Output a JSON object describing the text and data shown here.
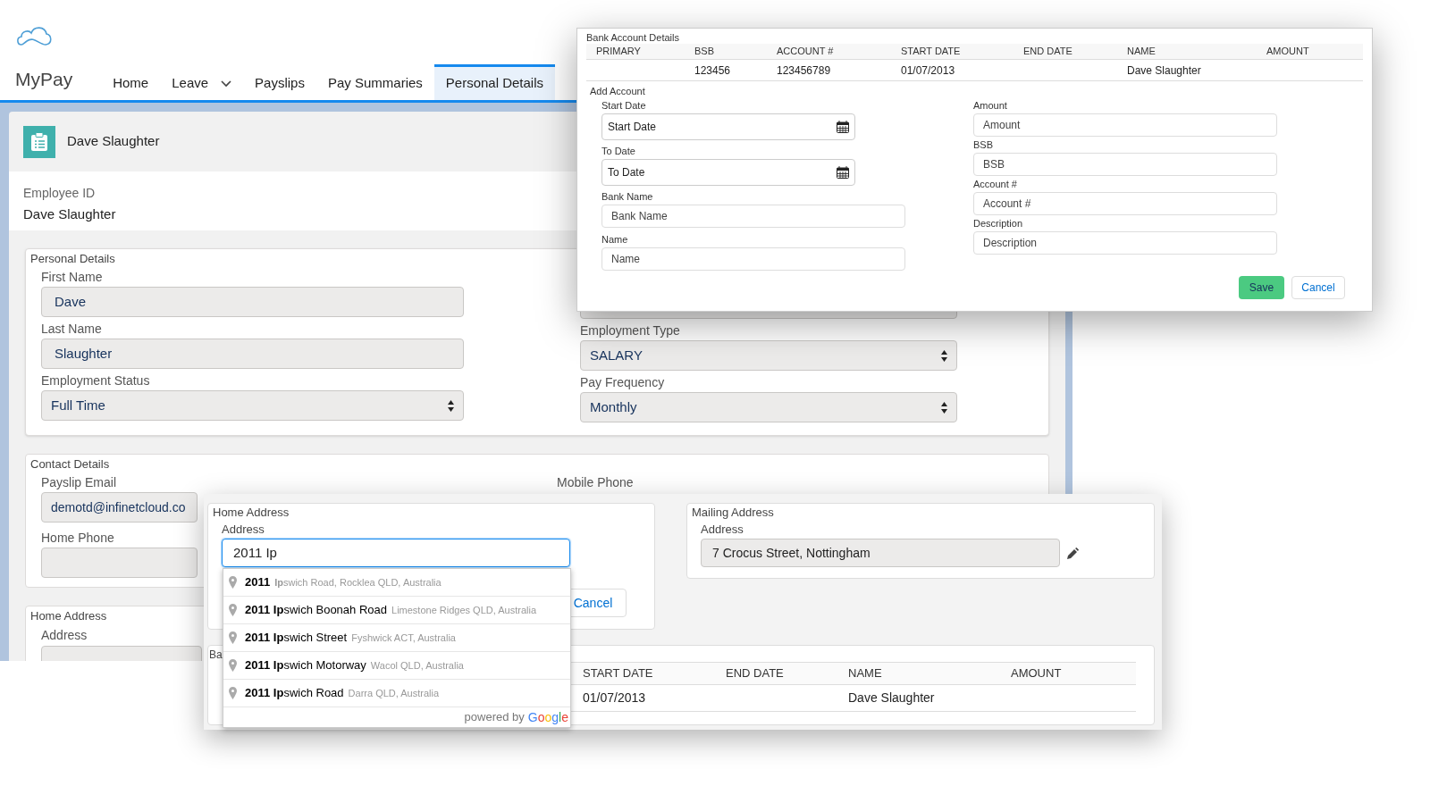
{
  "app": {
    "logo_text": "MyPay",
    "nav": [
      {
        "label": "Home",
        "selected": false,
        "dropdown": false
      },
      {
        "label": "Leave",
        "selected": false,
        "dropdown": true
      },
      {
        "label": "Payslips",
        "selected": false,
        "dropdown": false
      },
      {
        "label": "Pay Summaries",
        "selected": false,
        "dropdown": false
      },
      {
        "label": "Personal Details",
        "selected": true,
        "dropdown": false
      }
    ]
  },
  "profile": {
    "name": "Dave Slaughter",
    "employee_id_label": "Employee ID",
    "employee_id": "Dave Slaughter"
  },
  "personal_details": {
    "title": "Personal Details",
    "left": [
      {
        "label": "First Name",
        "value": "Dave",
        "kind": "text"
      },
      {
        "label": "Last Name",
        "value": "Slaughter",
        "kind": "text"
      },
      {
        "label": "Employment Status",
        "value": "Full Time",
        "kind": "select"
      }
    ],
    "right": [
      {
        "label": "Employment Type",
        "value": "SALARY",
        "kind": "select"
      },
      {
        "label": "Pay Frequency",
        "value": "Monthly",
        "kind": "select"
      }
    ]
  },
  "contact_details": {
    "title": "Contact Details",
    "payslip_email_label": "Payslip Email",
    "payslip_email": "demotd@infinetcloud.co",
    "home_phone_label": "Home Phone",
    "mobile_phone_label": "Mobile Phone"
  },
  "home_address_base": {
    "title": "Home Address",
    "address_label": "Address"
  },
  "bank_dialog": {
    "title": "Bank Account Details",
    "columns": [
      "PRIMARY",
      "BSB",
      "ACCOUNT #",
      "START DATE",
      "END DATE",
      "NAME",
      "AMOUNT"
    ],
    "rows": [
      [
        "",
        "123456",
        "123456789",
        "01/07/2013",
        "",
        "Dave Slaughter",
        ""
      ]
    ],
    "add_account": "Add Account",
    "left_fields": [
      {
        "label": "Start Date",
        "placeholder": "Start Date",
        "kind": "date"
      },
      {
        "label": "To Date",
        "placeholder": "To Date",
        "kind": "date"
      },
      {
        "label": "Bank Name",
        "placeholder": "Bank Name",
        "kind": "text"
      },
      {
        "label": "Name",
        "placeholder": "Name",
        "kind": "text"
      }
    ],
    "right_fields": [
      {
        "label": "Amount",
        "placeholder": "Amount",
        "kind": "text"
      },
      {
        "label": "BSB",
        "placeholder": "BSB",
        "kind": "text"
      },
      {
        "label": "Account #",
        "placeholder": "Account #",
        "kind": "text"
      },
      {
        "label": "Description",
        "placeholder": "Description",
        "kind": "text"
      }
    ],
    "save": "Save",
    "cancel": "Cancel"
  },
  "address_overlay": {
    "home_address": {
      "title": "Home Address",
      "address_label": "Address",
      "value": "2011 Ip",
      "focused": true,
      "cancel": "Cancel",
      "suggestions": [
        {
          "main": "**2011**",
          "secondary": "**Ip**swich Road, Rocklea QLD, Australia"
        },
        {
          "main": "**2011 Ip**swich Boonah Road",
          "secondary": "Limestone Ridges QLD, Australia"
        },
        {
          "main": "**2011 Ip**swich Street",
          "secondary": "Fyshwick ACT, Australia"
        },
        {
          "main": "**2011 Ip**swich Motorway",
          "secondary": "Wacol QLD, Australia"
        },
        {
          "main": "**2011 Ip**swich Road",
          "secondary": "Darra QLD, Australia"
        }
      ],
      "powered_by": "powered by",
      "powered_brand": "Google"
    },
    "mailing_address": {
      "title": "Mailing Address",
      "address_label": "Address",
      "value": "7 Crocus Street, Nottingham"
    },
    "bank": {
      "title": "Ba",
      "columns": [
        "START DATE",
        "END DATE",
        "NAME",
        "AMOUNT"
      ],
      "rows": [
        [
          "01/07/2013",
          "",
          "Dave Slaughter",
          ""
        ]
      ]
    }
  }
}
